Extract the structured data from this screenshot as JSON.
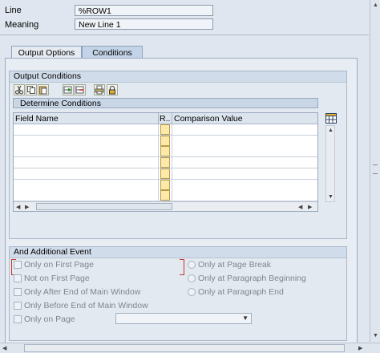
{
  "header": {
    "line_label": "Line",
    "line_value": "%ROW1",
    "meaning_label": "Meaning",
    "meaning_value": "New Line 1"
  },
  "tabs": [
    {
      "label": "Output Options",
      "active": false
    },
    {
      "label": "Conditions",
      "active": true
    }
  ],
  "output_conditions": {
    "title": "Output Conditions",
    "toolbar_icons": [
      "cut-icon",
      "copy-icon",
      "paste-icon",
      "insert-row-icon",
      "delete-row-icon",
      "print-icon",
      "lock-icon"
    ],
    "table": {
      "title": "Determine Conditions",
      "columns": [
        "Field Name",
        "R..",
        "Comparison Value"
      ],
      "row_count": 7,
      "settings_icon": "table-settings-icon"
    }
  },
  "additional_event": {
    "title": "And Additional Event",
    "checkboxes": [
      "Only on First Page",
      "Not on First Page",
      "Only After End of Main Window",
      "Only Before End of Main Window",
      "Only on Page"
    ],
    "radios": [
      "Only at Page Break",
      "Only at Paragraph Beginning",
      "Only at Paragraph End"
    ],
    "page_select_value": ""
  },
  "colors": {
    "background": "#dfe6ef",
    "tab_active": "#c4d4e8",
    "condition_button": "#ffe9a8",
    "focus_marker": "#c0392b"
  }
}
